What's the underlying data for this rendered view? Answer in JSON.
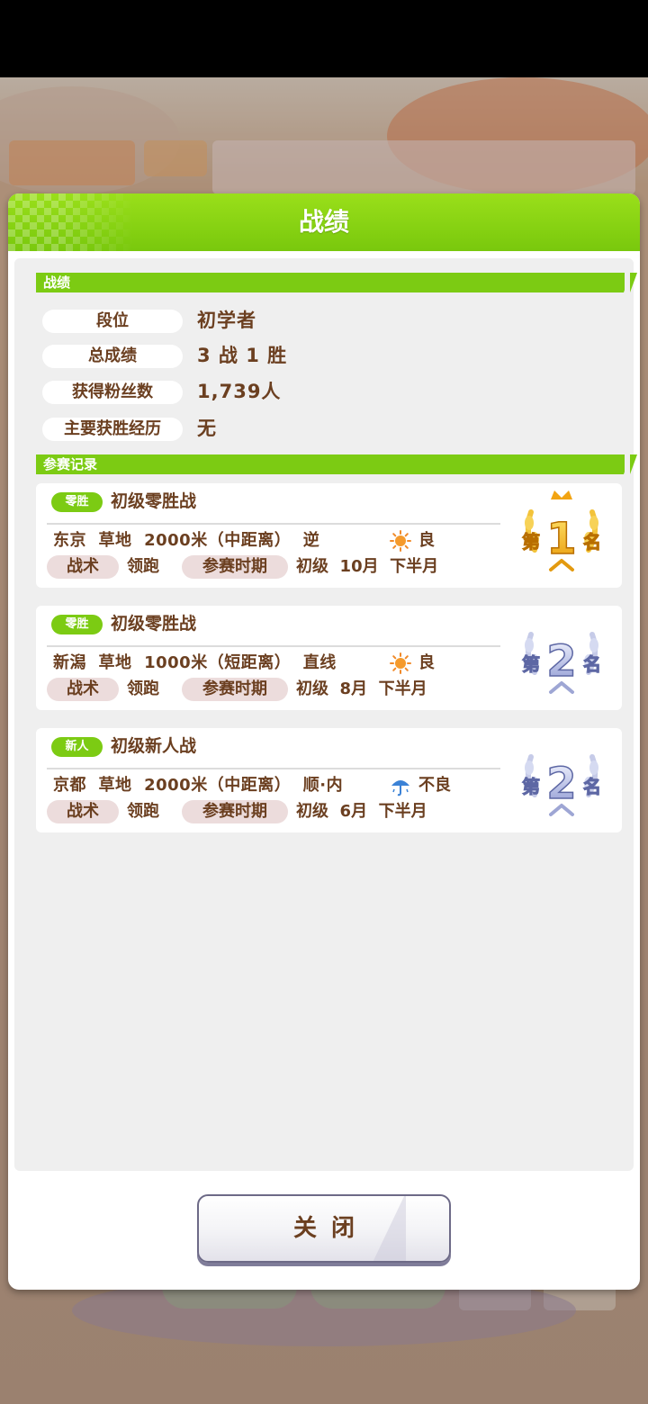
{
  "dialog": {
    "title": "战绩"
  },
  "record_section": {
    "title": "战绩",
    "rows": [
      {
        "label": "段位",
        "value": "初学者"
      },
      {
        "label": "总成绩",
        "value": "3 战 1 胜"
      },
      {
        "label": "获得粉丝数",
        "value": "1,739人"
      },
      {
        "label": "主要获胜经历",
        "value": "无"
      }
    ]
  },
  "history_section": {
    "title": "参赛记录",
    "races": [
      {
        "tag": "零胜",
        "name": "初级零胜战",
        "venue": "东京",
        "surface": "草地",
        "distance": "2000米（中距离）",
        "direction": "逆",
        "weather_icon": "sun-icon",
        "condition": "良",
        "tactic_label": "战术",
        "tactic": "领跑",
        "period_label": "参赛时期",
        "grade": "初级",
        "month": "10月",
        "half": "下半月",
        "placement": 1,
        "badge_prefix": "第",
        "badge_suffix": "名",
        "badge_color": "#f2b50f"
      },
      {
        "tag": "零胜",
        "name": "初级零胜战",
        "venue": "新潟",
        "surface": "草地",
        "distance": "1000米（短距离）",
        "direction": "直线",
        "weather_icon": "sun-icon",
        "condition": "良",
        "tactic_label": "战术",
        "tactic": "领跑",
        "period_label": "参赛时期",
        "grade": "初级",
        "month": "8月",
        "half": "下半月",
        "placement": 2,
        "badge_prefix": "第",
        "badge_suffix": "名",
        "badge_color": "#8f9bd6"
      },
      {
        "tag": "新人",
        "name": "初级新人战",
        "venue": "京都",
        "surface": "草地",
        "distance": "2000米（中距离）",
        "direction": "顺·内",
        "weather_icon": "umbrella-icon",
        "condition": "不良",
        "tactic_label": "战术",
        "tactic": "领跑",
        "period_label": "参赛时期",
        "grade": "初级",
        "month": "6月",
        "half": "下半月",
        "placement": 2,
        "badge_prefix": "第",
        "badge_suffix": "名",
        "badge_color": "#8f9bd6"
      }
    ]
  },
  "close_button": {
    "label": "关闭"
  },
  "colors": {
    "accent_green": "#7ccb13",
    "text_brown": "#6b3f20"
  }
}
